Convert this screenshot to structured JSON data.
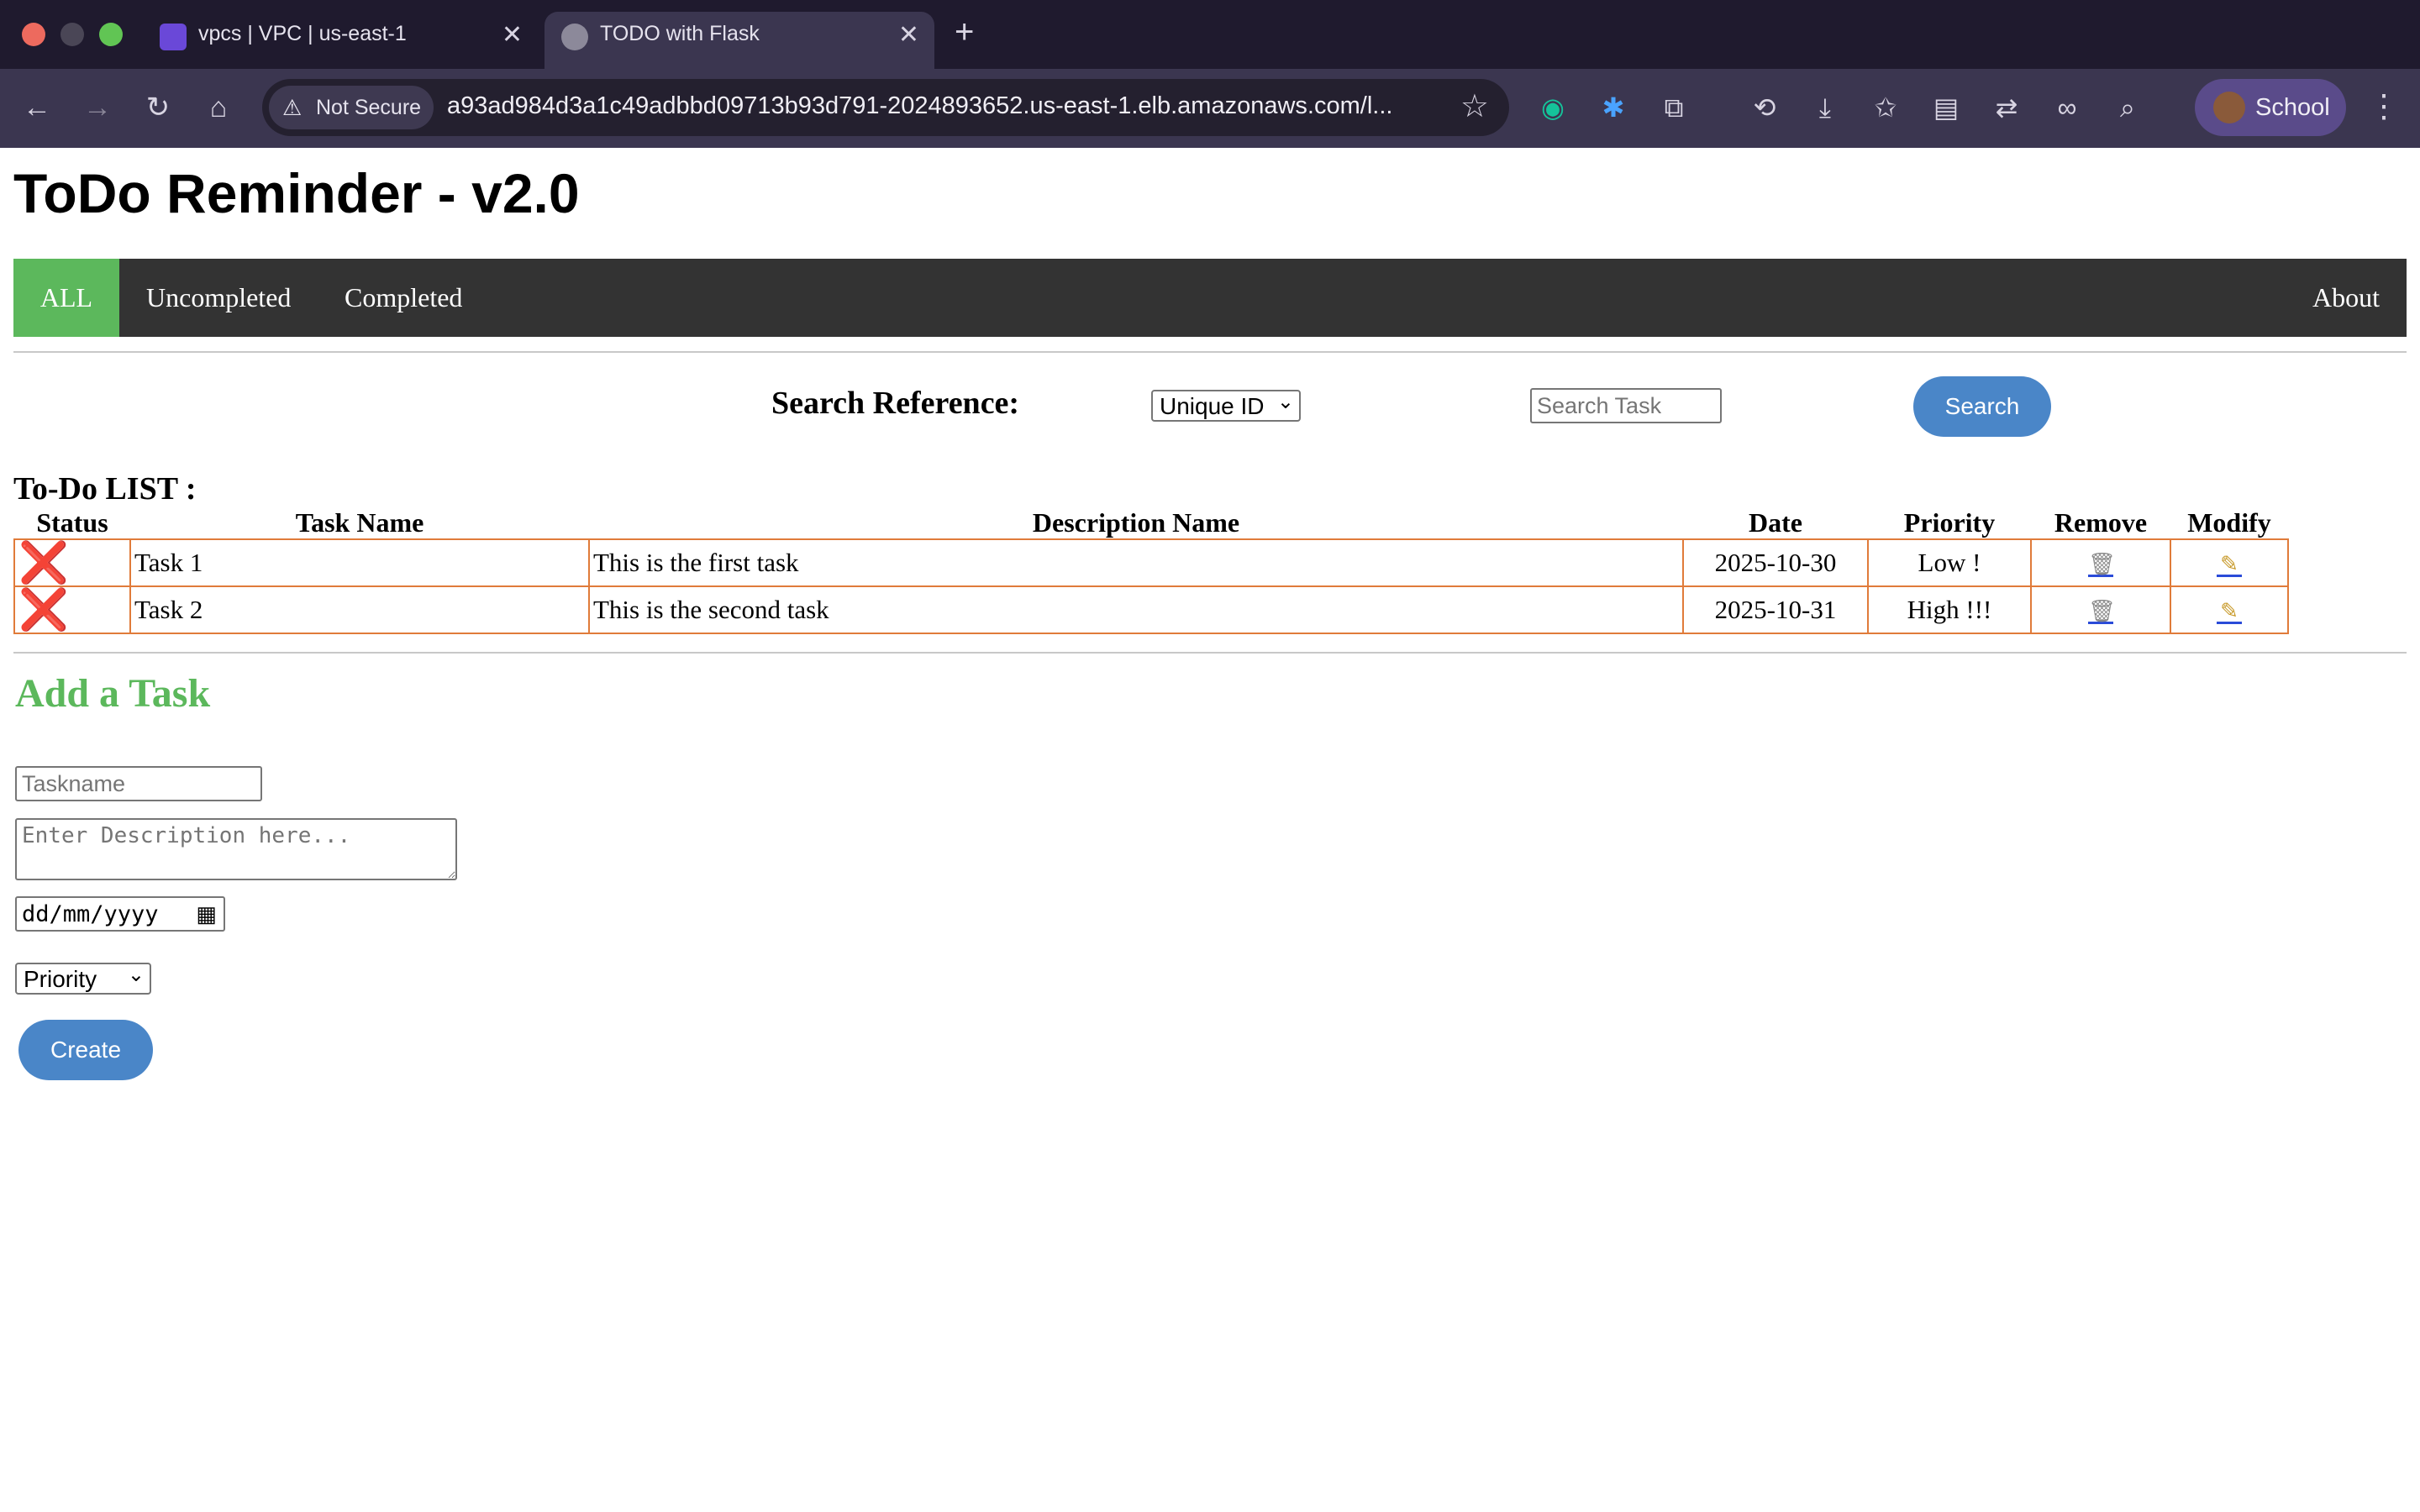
{
  "browser": {
    "tabs": [
      {
        "title": "vpcs | VPC | us-east-1",
        "active": false,
        "icon": "aws-vpc-icon"
      },
      {
        "title": "TODO with Flask",
        "active": true,
        "icon": "globe-icon"
      }
    ],
    "new_tab_symbol": "+",
    "close_symbol": "✕",
    "security_label": "Not Secure",
    "url": "a93ad984d3a1c49adbbd09713b93d791-2024893652.us-east-1.elb.amazonaws.com/l...",
    "profile_name": "School"
  },
  "page": {
    "title": "ToDo Reminder - v2.0",
    "nav": {
      "all": "ALL",
      "uncompleted": "Uncompleted",
      "completed": "Completed",
      "about": "About",
      "active_color": "#5cb85c"
    },
    "search": {
      "label": "Search Reference:",
      "select_value": "Unique ID",
      "input_placeholder": "Search Task",
      "button": "Search"
    },
    "list": {
      "title": "To-Do LIST :",
      "headers": {
        "status": "Status",
        "task": "Task Name",
        "description": "Description Name",
        "date": "Date",
        "priority": "Priority",
        "remove": "Remove",
        "modify": "Modify"
      },
      "rows": [
        {
          "status": "❌",
          "task": "Task 1",
          "description": "This is the first task",
          "date": "2025-10-30",
          "priority": "Low !"
        },
        {
          "status": "❌",
          "task": "Task 2",
          "description": "This is the second task",
          "date": "2025-10-31",
          "priority": "High !!!"
        }
      ]
    },
    "add": {
      "title": "Add a Task",
      "taskname_placeholder": "Taskname",
      "description_placeholder": "Enter Description here...",
      "date_placeholder": "dd/mm/yyyy",
      "priority_value": "Priority",
      "create_button": "Create"
    }
  }
}
